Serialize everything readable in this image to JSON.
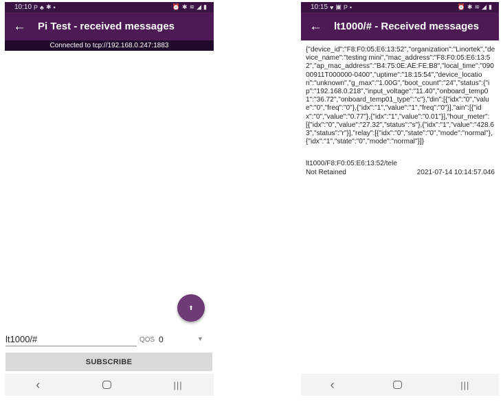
{
  "left": {
    "status": {
      "time": "10:10",
      "left_icons": [
        "P",
        "♣",
        "✱",
        "•"
      ],
      "right_icons": [
        "⏰",
        "✱",
        "≋",
        "◢",
        "▮"
      ]
    },
    "appbar": {
      "title": "Pi Test - received messages"
    },
    "connection": "Connected to tcp://192.168.0.247:1883",
    "fab": {
      "icon": "upload-icon",
      "glyph": "⬆"
    },
    "topic_input": "lt1000/#",
    "qos": {
      "label": "QOS",
      "value": "0"
    },
    "subscribe_label": "SUBSCRIBE",
    "nav": {
      "back": "‹",
      "recents": "|||"
    }
  },
  "right": {
    "status": {
      "time": "10:15",
      "left_icons": [
        "♥",
        "▣",
        "P",
        "•"
      ],
      "right_icons": [
        "⏰",
        "✱",
        "≋",
        "◢",
        "▮"
      ]
    },
    "appbar": {
      "title": "lt1000/# - Received messages"
    },
    "message": {
      "payload": "{\"device_id\":\"F8:F0:05:E6:13:52\",\"organization\":\"Linortek\",\"device_name\":\"testing mini\",\"mac_address\":\"F8:F0:05:E6:13:52\",\"ap_mac_address\":\"B4:75:0E:AE:FE:B8\",\"local_time\":\"09000911T000000-0400\",\"uptime\":\"18:15:54\",\"device_location\":\"unknown\",\"g_max\":\"1.00G\",\"boot_count\":\"24\",\"status\":{\"ip\":\"192.168.0.218\",\"input_voltage\":\"11.40\",\"onboard_temp01\":\"36.72\",\"onboard_temp01_type\":\"c\"},\"din\":[{\"idx\":\"0\",\"value\":\"0\",\"freq\":\"0\"},{\"idx\":\"1\",\"value\":\"1\",\"freq\":\"0\"}],\"ain\":[{\"idx\":\"0\",\"value\":\"0.77\"},{\"idx\":\"1\",\"value\":\"0.01\"}],\"hour_meter\":[{\"idx\":\"0\",\"value\":\"27.32\",\"status\":\"s\"},{\"idx\":\"1\",\"value\":\"428.63\",\"status\":\"r\"}],\"relay\":[{\"idx\":\"0\",\"state\":\"0\",\"mode\":\"normal\"},{\"idx\":\"1\",\"state\":\"0\",\"mode\":\"normal\"}]}",
      "topic": "lt1000/F8:F0:05:E6:13:52/tele",
      "retained": "Not Retained",
      "timestamp": "2021-07-14 10:14:57.046"
    },
    "nav": {
      "back": "‹",
      "recents": "|||"
    }
  },
  "colors": {
    "appbar": "#4d1a55",
    "statusbar": "#3a1344",
    "connection_bar": "#20092a",
    "fab": "#6e3b77",
    "button": "#d9d9d9"
  }
}
